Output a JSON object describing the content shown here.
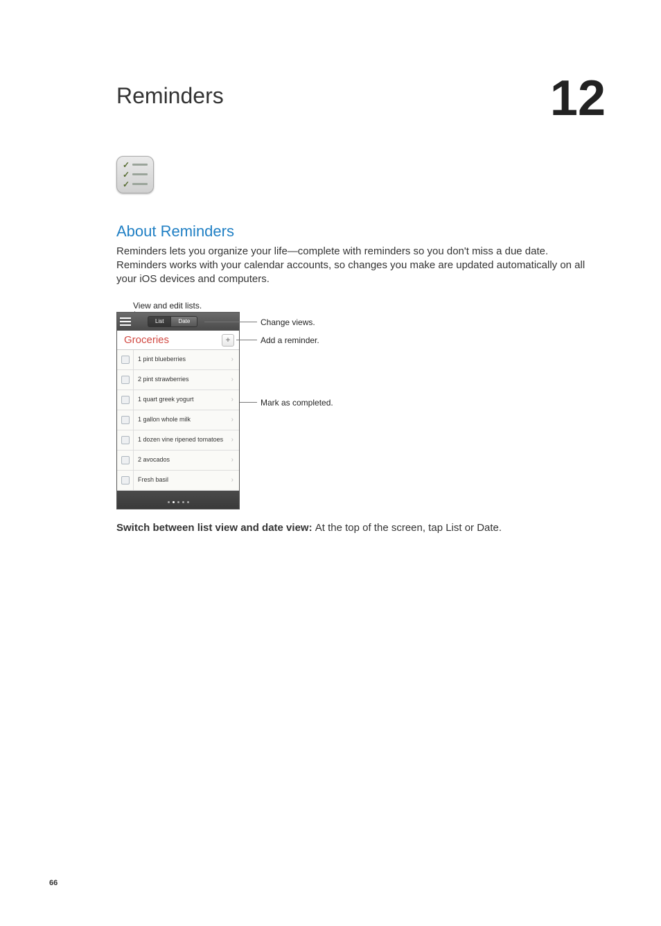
{
  "chapter": {
    "title": "Reminders",
    "number": "12"
  },
  "section": {
    "heading": "About Reminders"
  },
  "body": {
    "intro": "Reminders lets you organize your life—complete with reminders so you don't miss a due date. Reminders works with your calendar accounts, so changes you make are updated automatically on all your iOS devices and computers."
  },
  "callouts": {
    "top": "View and edit lists.",
    "change_views": "Change views.",
    "add_reminder": "Add a reminder.",
    "mark_completed": "Mark as completed."
  },
  "ui": {
    "seg": {
      "list": "List",
      "date": "Date"
    },
    "list_title": "Groceries",
    "items": [
      "1 pint blueberries",
      "2 pint strawberries",
      "1 quart greek yogurt",
      "1 gallon whole milk",
      "1 dozen vine ripened tomatoes",
      "2 avocados",
      "Fresh basil"
    ]
  },
  "footer": {
    "strong": "Switch between list view and date view:  ",
    "rest": "At the top of the screen, tap List or Date."
  },
  "page_number": "66"
}
